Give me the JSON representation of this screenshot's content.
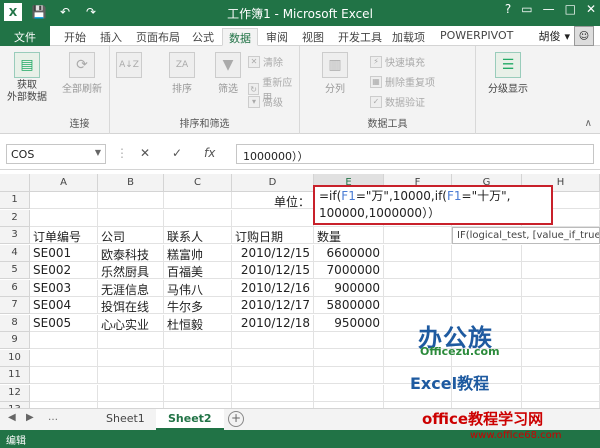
{
  "titlebar": {
    "title": "工作簿1 - Microsoft Excel",
    "qat": {
      "save": "💾",
      "undo": "↶",
      "redo": "↷"
    },
    "controls": {
      "help": "?",
      "restore": "▭",
      "min": "—",
      "max": "□",
      "close": "✕"
    }
  },
  "tabs": {
    "file": "文件",
    "items": [
      "开始",
      "插入",
      "页面布局",
      "公式",
      "数据",
      "审阅",
      "视图",
      "开发工具",
      "加载项",
      "POWERPIVOT"
    ],
    "active_index": 4,
    "user": "胡俊"
  },
  "ribbon": {
    "groups": {
      "connect": "连接",
      "sort_filter": "排序和筛选",
      "data_tools": "数据工具"
    },
    "buttons": {
      "get_external": "获取\n外部数据",
      "refresh_all": "全部刷新",
      "sort": "排序",
      "filter": "筛选",
      "clear": "清除",
      "reapply": "重新应用",
      "advanced": "高级",
      "text_to_columns": "分列",
      "flash_fill": "快速填充",
      "remove_dup": "删除重复项",
      "validation": "数据验证",
      "outline": "分级显示"
    }
  },
  "formula_bar": {
    "name_box": "COS",
    "cancel": "✕",
    "confirm": "✓",
    "fx": "fx",
    "content": "1000000））"
  },
  "grid": {
    "columns": [
      "A",
      "B",
      "C",
      "D",
      "E",
      "F",
      "G",
      "H"
    ],
    "rows": [
      "1",
      "2",
      "3",
      "4",
      "5",
      "6",
      "7",
      "8",
      "9",
      "10",
      "11",
      "12",
      "13"
    ],
    "unit_label": "单位：",
    "headers": [
      "订单编号",
      "公司",
      "联系人",
      "订购日期",
      "数量"
    ],
    "data": [
      [
        "SE001",
        "欧泰科技",
        "糕富帅",
        "2010/12/15",
        "6600000"
      ],
      [
        "SE002",
        "乐然厨具",
        "百福美",
        "2010/12/15",
        "7000000"
      ],
      [
        "SE003",
        "无涯信息",
        "马伟八",
        "2010/12/16",
        "900000"
      ],
      [
        "SE004",
        "投饵在线",
        "牛尔多",
        "2010/12/17",
        "5800000"
      ],
      [
        "SE005",
        "心心实业",
        "杜恒毅",
        "2010/12/18",
        "950000"
      ]
    ]
  },
  "formula_edit": {
    "p1": "=if(",
    "ref1": "F1",
    "p2": "=\"万\",10000,if(",
    "ref2": "F1",
    "p3": "=\"十万\",",
    "line2": "100000,1000000））"
  },
  "tooltip": "IF(logical_test, [value_if_true",
  "sheets": {
    "tabs": [
      "Sheet1",
      "Sheet2"
    ],
    "active_index": 1,
    "add": "+"
  },
  "status": "编辑",
  "watermark": {
    "brand": "办公族",
    "domain": "Officezu.com",
    "excel": "Excel教程",
    "site": "office教程学习网",
    "url": "www.office68.com"
  }
}
